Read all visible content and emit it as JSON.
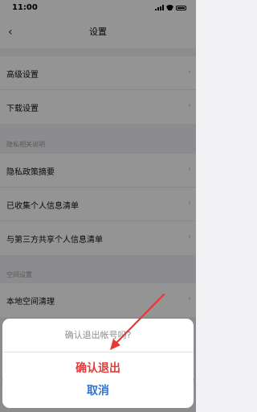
{
  "status_bar": {
    "time": "11:00"
  },
  "nav": {
    "title": "设置",
    "back_icon": "chevron-left-icon"
  },
  "group1": {
    "items": [
      {
        "label": "高级设置"
      },
      {
        "label": "下载设置"
      }
    ]
  },
  "privacy": {
    "header": "隐私相关说明",
    "items": [
      {
        "label": "隐私政策摘要"
      },
      {
        "label": "已收集个人信息清单"
      },
      {
        "label": "与第三方共享个人信息清单"
      }
    ]
  },
  "space": {
    "header": "空间设置",
    "items": [
      {
        "label": "本地空间清理"
      }
    ]
  },
  "action_sheet": {
    "title": "确认退出帐号吗?",
    "confirm_label": "确认退出",
    "cancel_label": "取消"
  },
  "colors": {
    "confirm": "#e43a3a",
    "cancel": "#2f73d8",
    "annotation_arrow": "#e53935"
  }
}
